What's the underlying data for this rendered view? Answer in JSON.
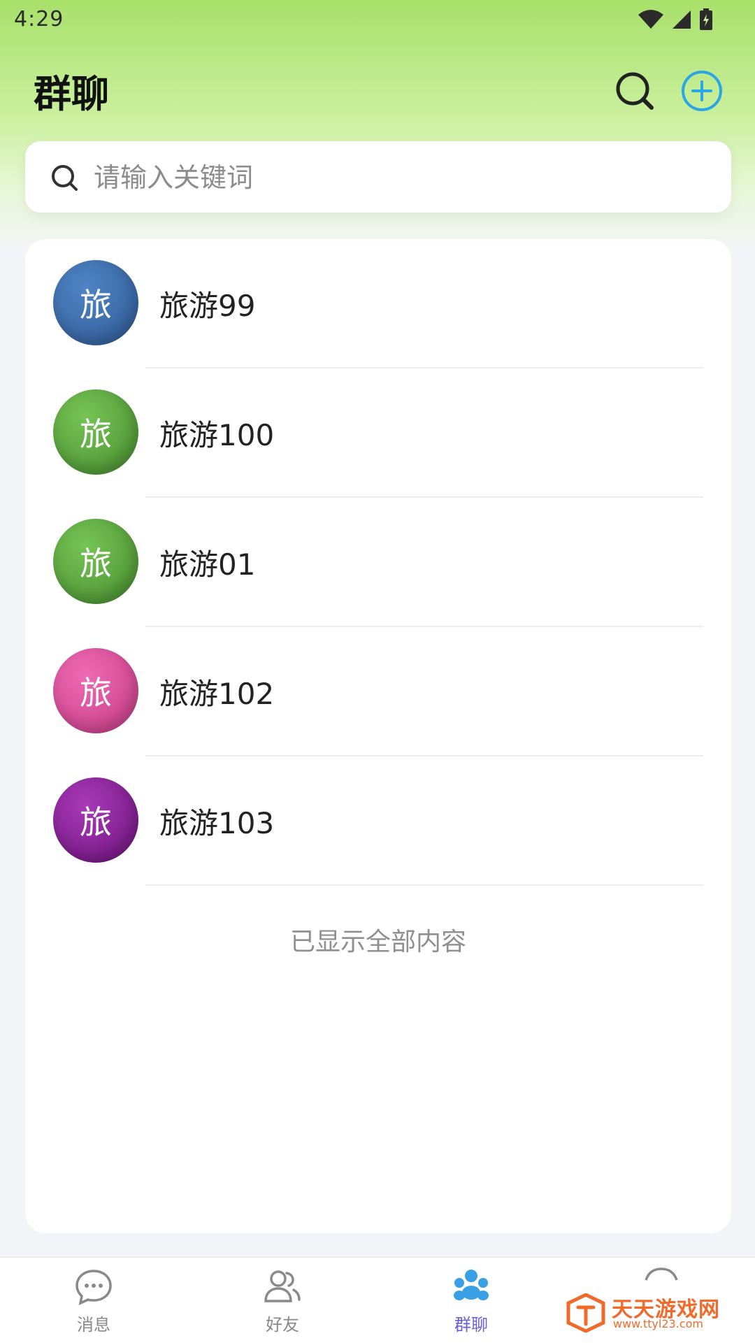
{
  "status_bar": {
    "time": "4:29"
  },
  "header": {
    "title": "群聊"
  },
  "search": {
    "placeholder": "请输入关键词"
  },
  "groups": [
    {
      "avatar_char": "旅",
      "name": "旅游99",
      "color": "#3a6aa9"
    },
    {
      "avatar_char": "旅",
      "name": "旅游100",
      "color": "#5aa33e"
    },
    {
      "avatar_char": "旅",
      "name": "旅游01",
      "color": "#5aa33e"
    },
    {
      "avatar_char": "旅",
      "name": "旅游102",
      "color": "#d94a98"
    },
    {
      "avatar_char": "旅",
      "name": "旅游103",
      "color": "#8a1a98"
    }
  ],
  "list_end_text": "已显示全部内容",
  "tabs": [
    {
      "label": "消息",
      "icon": "chat-bubble-icon",
      "active": false
    },
    {
      "label": "好友",
      "icon": "friends-icon",
      "active": false
    },
    {
      "label": "群聊",
      "icon": "group-chat-icon",
      "active": true
    }
  ],
  "watermark": {
    "title": "天天游戏网",
    "url": "www.ttyl23.com"
  },
  "colors": {
    "accent": "#6a5fd6",
    "add_icon": "#2aa6e6",
    "header_gradient_top": "#a8e06a",
    "watermark": "#f06a2a"
  }
}
